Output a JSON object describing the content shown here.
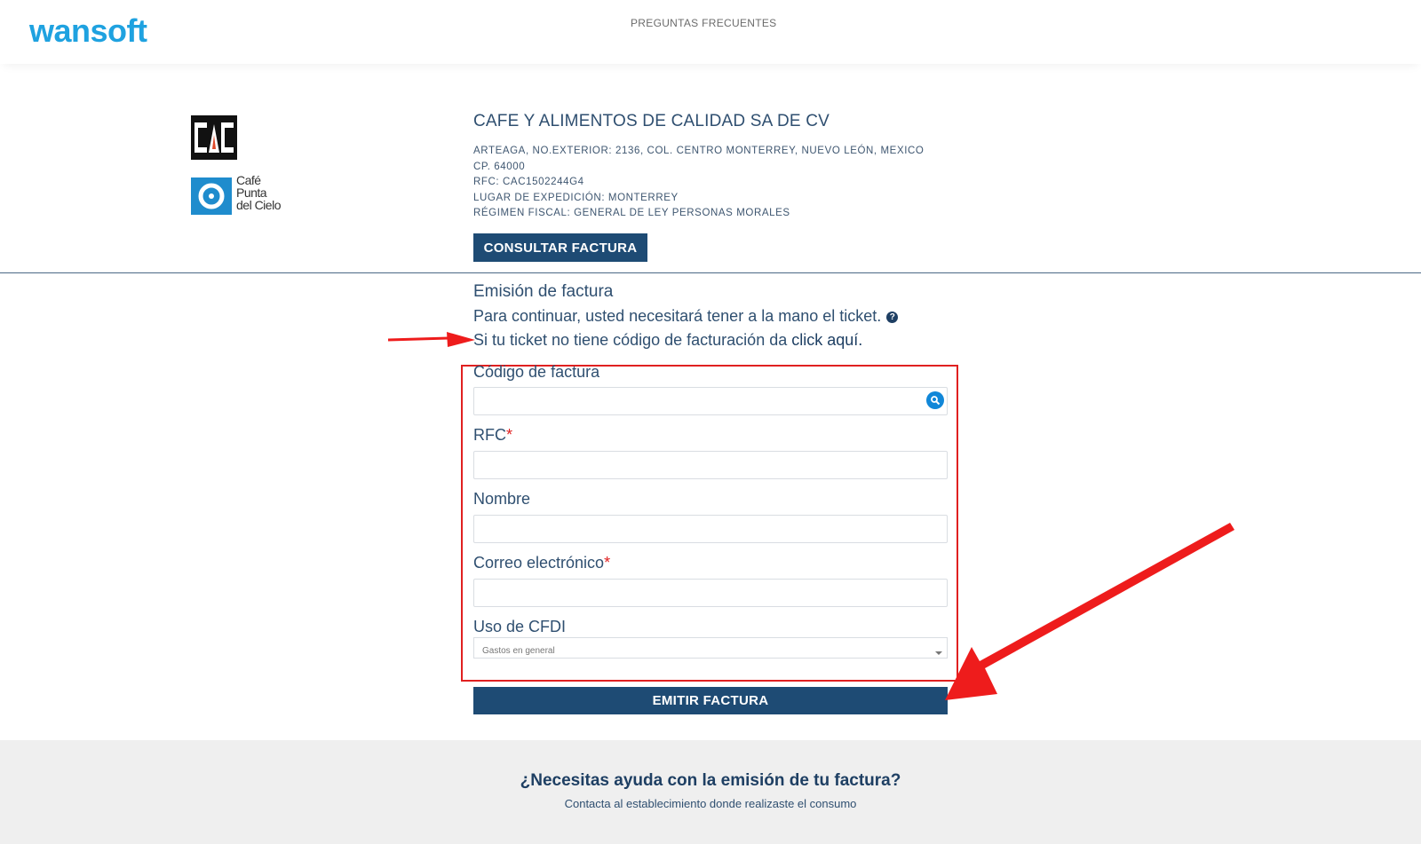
{
  "header": {
    "logo": "wansoft",
    "nav": {
      "faq": "PREGUNTAS FRECUENTES"
    }
  },
  "company": {
    "logo_text": "Café Punta del Cielo",
    "name": "CAFE Y ALIMENTOS DE CALIDAD SA DE CV",
    "address": "ARTEAGA, NO.EXTERIOR: 2136, COL. CENTRO   MONTERREY, NUEVO LEÓN, MEXICO",
    "cp": "CP. 64000",
    "rfc": "RFC: CAC1502244G4",
    "lugar": "LUGAR DE EXPEDICIÓN: MONTERREY",
    "regimen": "RÉGIMEN FISCAL: GENERAL DE LEY PERSONAS MORALES",
    "consult_button": "CONSULTAR FACTURA"
  },
  "form": {
    "title": "Emisión de factura",
    "intro": "Para continuar, usted necesitará tener a la mano el ticket.",
    "no_code_text": "Si tu ticket no tiene código de facturación da ",
    "no_code_link": "click aquí.",
    "fields": {
      "codigo_label": "Código de factura",
      "codigo_value": "",
      "rfc_label": "RFC",
      "rfc_value": "",
      "nombre_label": "Nombre",
      "nombre_value": "",
      "correo_label": "Correo electrónico",
      "correo_value": "",
      "cfdi_label": "Uso de CFDI",
      "cfdi_selected": "Gastos en general"
    },
    "required_mark": "*",
    "submit_button": "EMITIR FACTURA"
  },
  "footer": {
    "title": "¿Necesitas ayuda con la emisión de tu factura?",
    "text": "Contacta al establecimiento donde realizaste el consumo"
  },
  "colors": {
    "brand": "#1fa2e0",
    "primary_button": "#1e4b74",
    "annotation": "#e02020"
  }
}
